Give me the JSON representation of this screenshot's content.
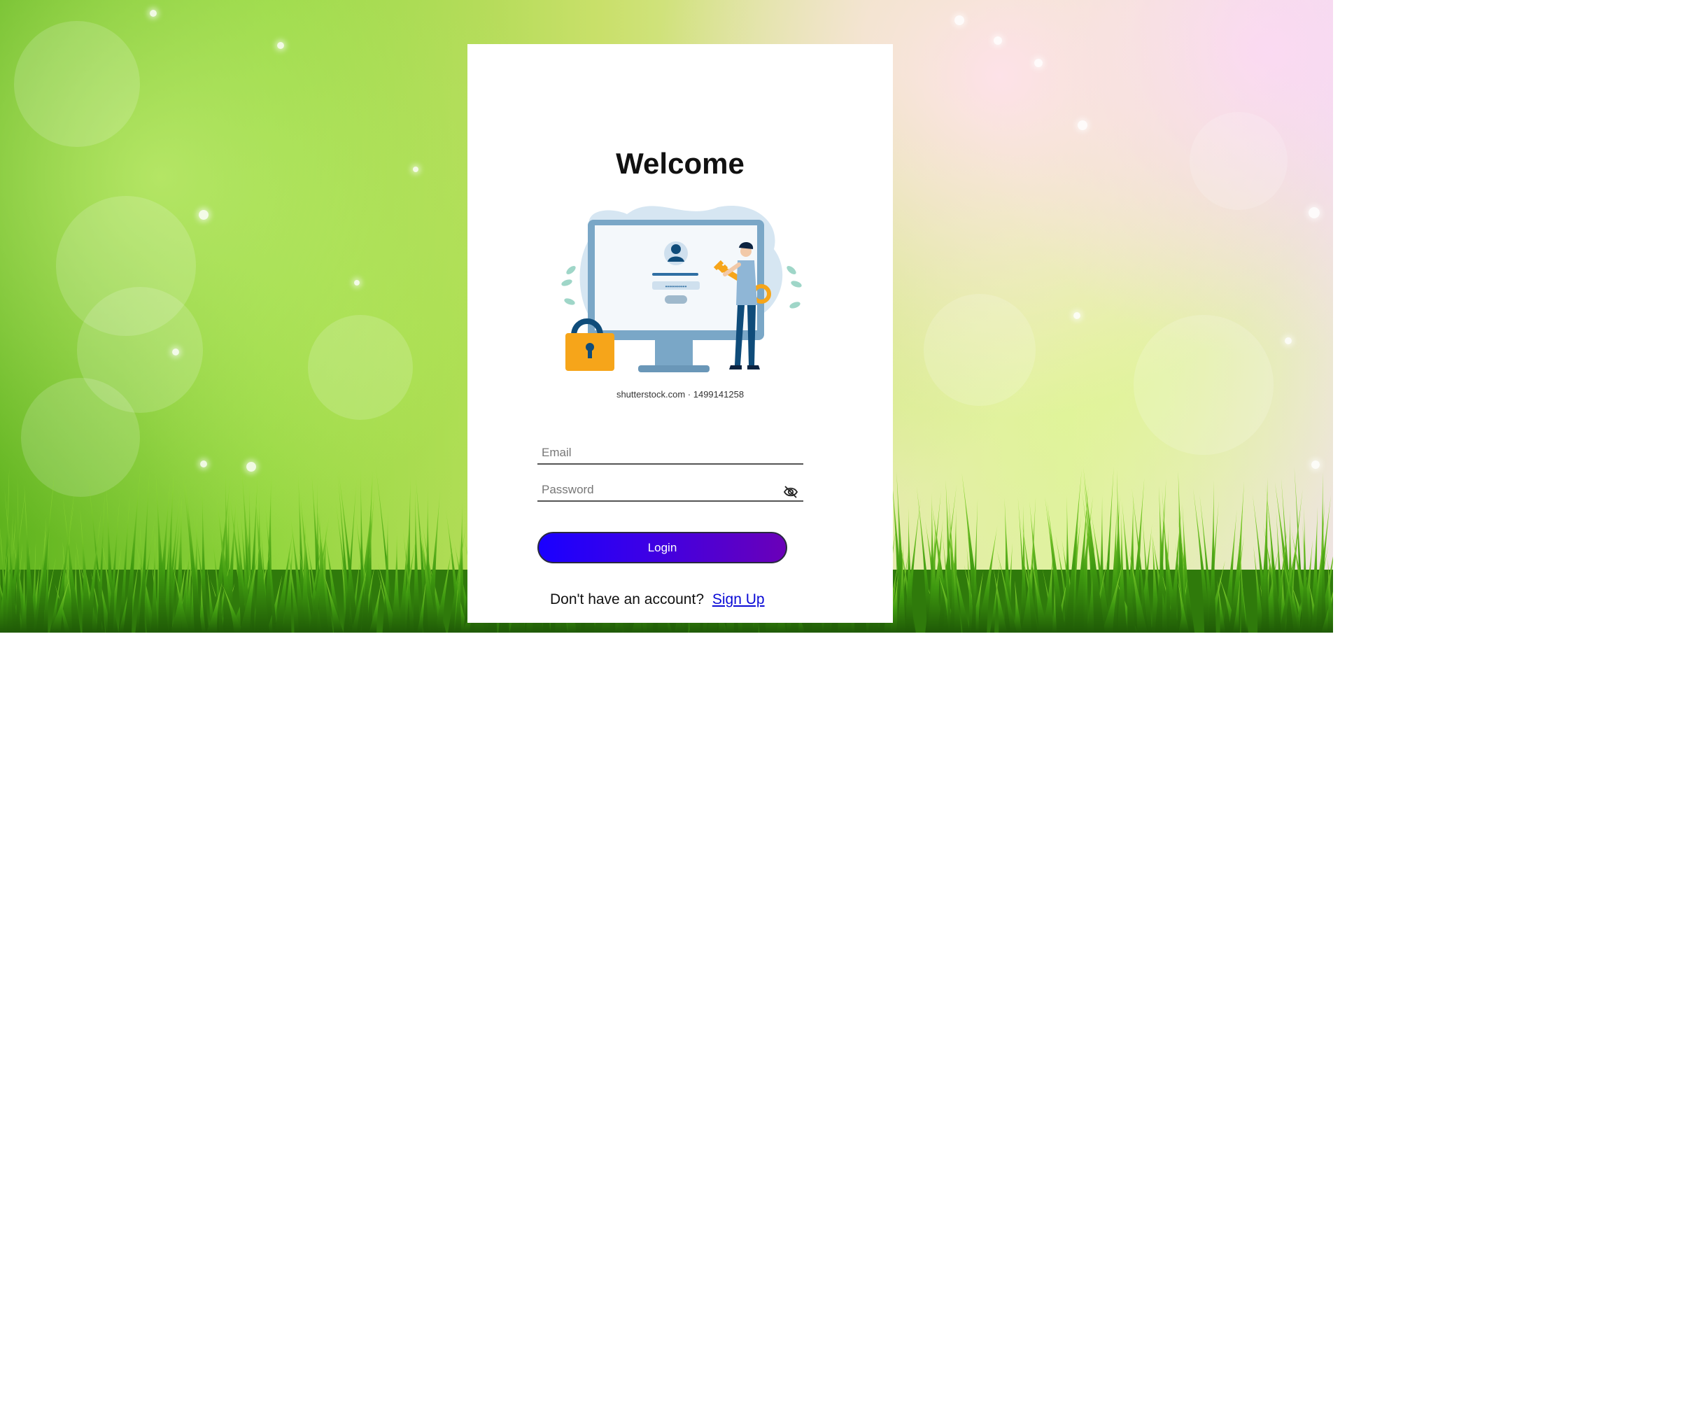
{
  "page": {
    "title": "Welcome",
    "image_credit": "shutterstock.com · 1499141258"
  },
  "form": {
    "email_placeholder": "Email",
    "email_value": "",
    "password_placeholder": "Password",
    "password_value": "",
    "password_toggle_icon": "eye-slash-icon",
    "login_label": "Login"
  },
  "footer": {
    "prompt": "Don't have an account?",
    "signup_label": "Sign Up"
  },
  "colors": {
    "button_gradient_start": "#1a00ff",
    "button_gradient_end": "#6a00b8",
    "link": "#0a0ad6",
    "card_background": "#ffffff"
  }
}
